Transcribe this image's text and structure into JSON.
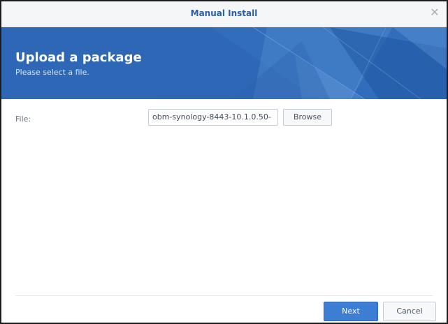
{
  "dialog": {
    "title": "Manual Install",
    "close_icon": "close-icon",
    "close_glyph": "✕"
  },
  "banner": {
    "title": "Upload a package",
    "subtitle": "Please select a file."
  },
  "form": {
    "file_label": "File:",
    "file_value": "obm-synology-8443-10.1.0.50-",
    "browse_label": "Browse"
  },
  "footer": {
    "next_label": "Next",
    "cancel_label": "Cancel"
  },
  "colors": {
    "accent": "#2d67b5",
    "title_text": "#2a5fa3",
    "primary_button": "#3c7ed4"
  }
}
